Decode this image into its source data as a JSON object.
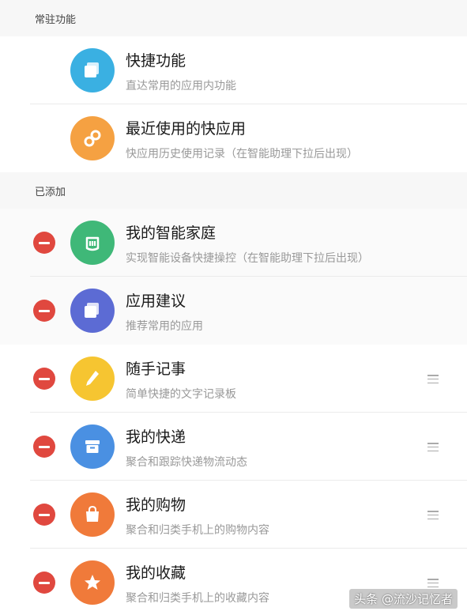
{
  "sections": {
    "pinned_label": "常驻功能",
    "added_label": "已添加"
  },
  "pinned": [
    {
      "title": "快捷功能",
      "subtitle": "直达常用的应用内功能",
      "icon": "cards-icon",
      "color": "#3ab0e2"
    },
    {
      "title": "最近使用的快应用",
      "subtitle": "快应用历史使用记录（在智能助理下拉后出现）",
      "icon": "link-icon",
      "color": "#f5a142"
    }
  ],
  "added": [
    {
      "title": "我的智能家庭",
      "subtitle": "实现智能设备快捷操控（在智能助理下拉后出现）",
      "icon": "mi-home-icon",
      "color": "#3fb878"
    },
    {
      "title": "应用建议",
      "subtitle": "推荐常用的应用",
      "icon": "cards-icon",
      "color": "#5c6bd4"
    },
    {
      "title": "随手记事",
      "subtitle": "简单快捷的文字记录板",
      "icon": "pencil-icon",
      "color": "#f6c531"
    },
    {
      "title": "我的快递",
      "subtitle": "聚合和跟踪快递物流动态",
      "icon": "package-icon",
      "color": "#4a90e2"
    },
    {
      "title": "我的购物",
      "subtitle": "聚合和归类手机上的购物内容",
      "icon": "shopping-bag-icon",
      "color": "#f07a3a"
    },
    {
      "title": "我的收藏",
      "subtitle": "聚合和归类手机上的收藏内容",
      "icon": "star-icon",
      "color": "#f07a3a"
    }
  ],
  "watermark": "头条 @流沙记忆者"
}
